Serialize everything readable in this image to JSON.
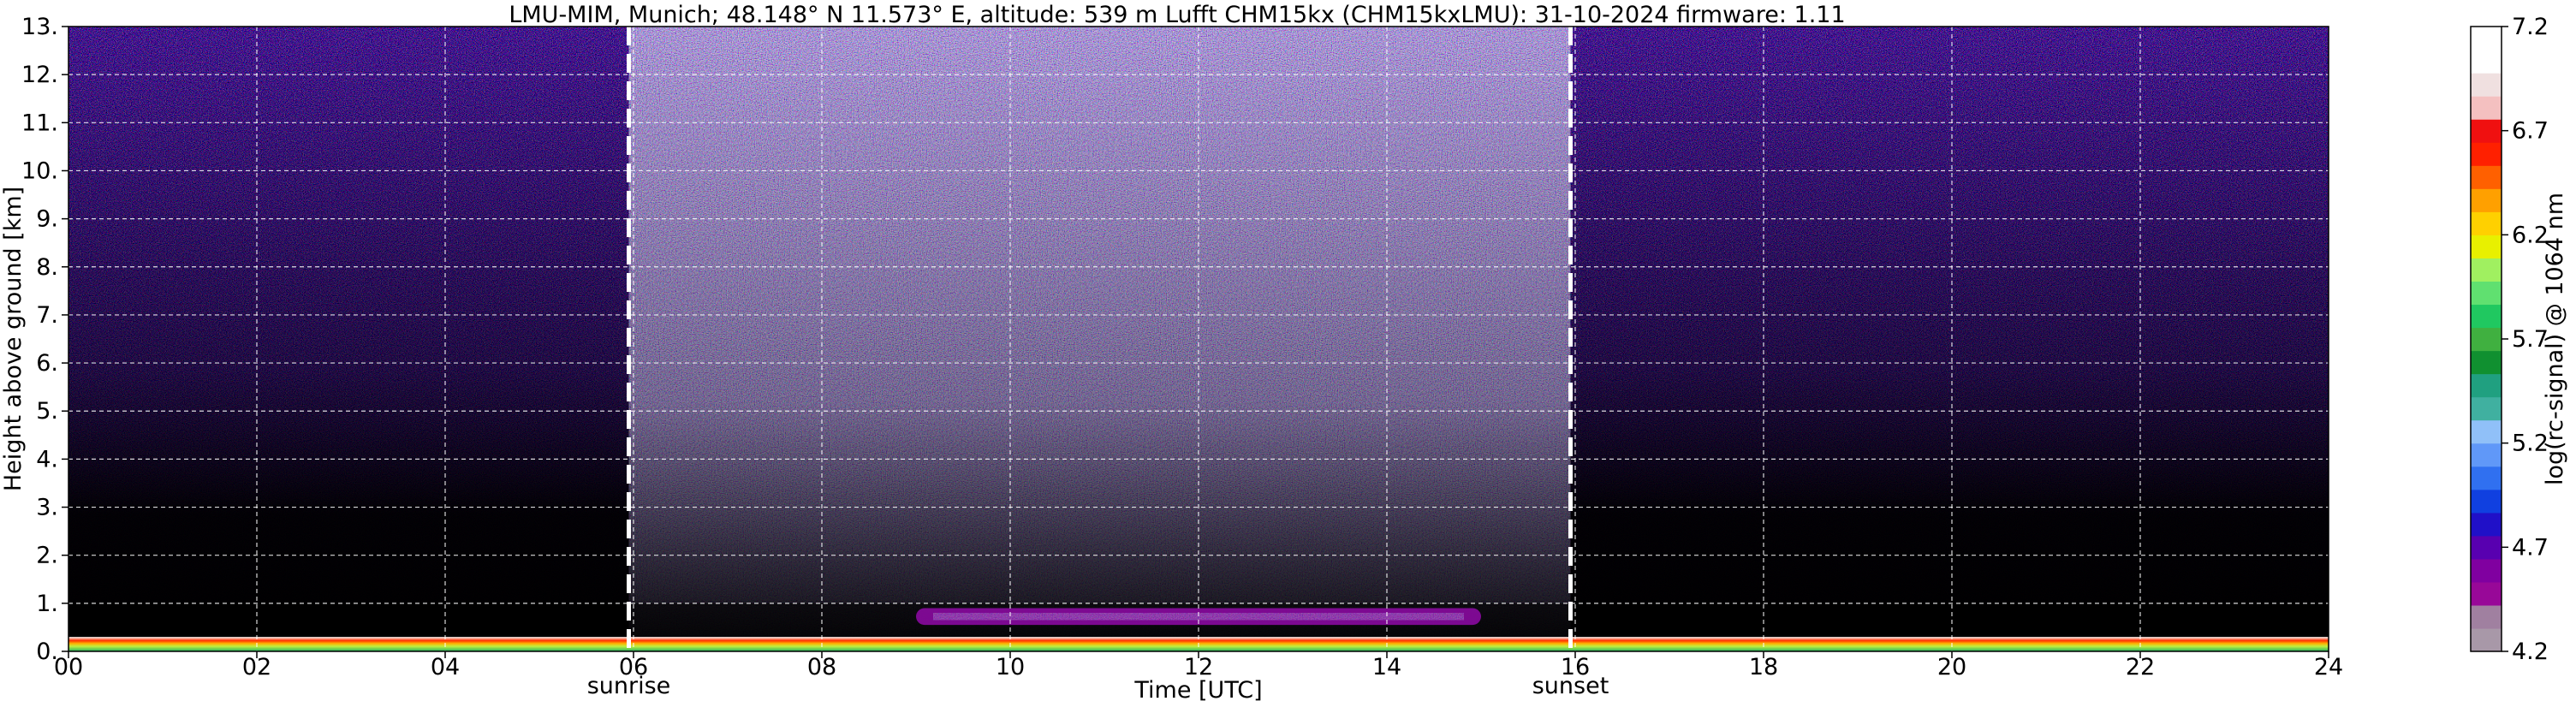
{
  "chart_data": {
    "type": "heatmap",
    "title": "LMU-MIM, Munich; 48.148° N 11.573° E, altitude: 539 m    Lufft CHM15kx (CHM15kxLMU): 31-10-2024    firmware: 1.11",
    "xlabel": "Time [UTC]",
    "ylabel": "Height above ground [km]",
    "xlim": [
      0,
      24
    ],
    "ylim": [
      0,
      13
    ],
    "x_ticks": [
      0,
      2,
      4,
      6,
      8,
      10,
      12,
      14,
      16,
      18,
      20,
      22,
      24
    ],
    "x_tick_labels": [
      "00",
      "02",
      "04",
      "06",
      "08",
      "10",
      "12",
      "14",
      "16",
      "18",
      "20",
      "22",
      "24"
    ],
    "y_ticks": [
      0,
      1,
      2,
      3,
      4,
      5,
      6,
      7,
      8,
      9,
      10,
      11,
      12,
      13
    ],
    "y_tick_labels": [
      "0.",
      "1.",
      "2.",
      "3.",
      "4.",
      "5.",
      "6.",
      "7.",
      "8.",
      "9.",
      "10.",
      "11.",
      "12.",
      "13."
    ],
    "grid": true,
    "events": [
      {
        "label": "sunrise",
        "time": 5.95
      },
      {
        "label": "sunset",
        "time": 15.95
      }
    ],
    "colorbar": {
      "label": "log(rc-signal) @ 1064 nm",
      "range": [
        4.2,
        7.2
      ],
      "ticks": [
        4.2,
        4.7,
        5.2,
        5.7,
        6.2,
        6.7,
        7.2
      ],
      "tick_labels": [
        "4.2",
        "4.7",
        "5.2",
        "5.7",
        "6.2",
        "6.7",
        "7.2"
      ],
      "colors": [
        "#a898a8",
        "#a080a0",
        "#980898",
        "#8000a0",
        "#5800b0",
        "#2010c8",
        "#1040e0",
        "#3070f0",
        "#6098f8",
        "#90c0f8",
        "#40b0a0",
        "#20a080",
        "#109030",
        "#40b040",
        "#20c860",
        "#60e070",
        "#a0f060",
        "#e8f000",
        "#ffd000",
        "#ffa000",
        "#ff6000",
        "#ff2000",
        "#f01010",
        "#f4c0c0",
        "#f0e0e0",
        "#ffffff",
        "#ffffff"
      ]
    },
    "features": [
      {
        "name": "cloud layer",
        "time_range": [
          9.0,
          15.0
        ],
        "height_range_km": [
          0.55,
          0.9
        ],
        "log_signal_approx": 4.8
      },
      {
        "name": "boundary layer",
        "time_range": [
          0.0,
          24.0
        ],
        "height_range_km": [
          0.0,
          0.3
        ],
        "log_signal_approx": 5.9
      },
      {
        "name": "daylight noise",
        "time_range": [
          5.95,
          15.95
        ],
        "height_range_km": [
          1.0,
          13.0
        ],
        "log_signal_approx": 4.5
      }
    ]
  }
}
